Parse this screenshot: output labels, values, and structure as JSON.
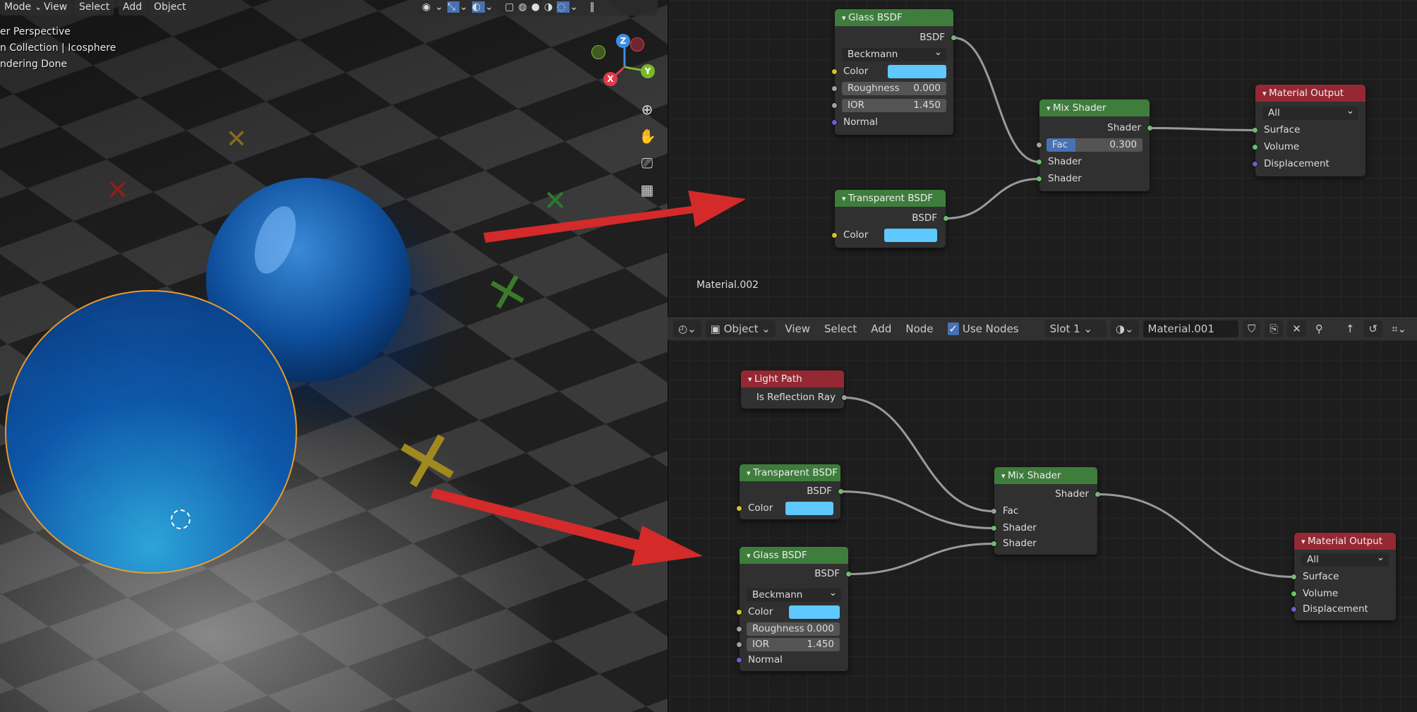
{
  "viewport": {
    "menu": [
      "Mode",
      "View",
      "Select",
      "Add",
      "Object"
    ],
    "overlay": [
      "er Perspective",
      "n Collection | Icosphere",
      "ndering Done"
    ],
    "gizmo": {
      "z": "Z",
      "y": "Y",
      "x": "X"
    },
    "tools": [
      "zoom-icon",
      "hand-icon",
      "camera-icon",
      "grid-icon"
    ]
  },
  "top_editor": {
    "material_label": "Material.002",
    "glass": {
      "title": "Glass BSDF",
      "out": "BSDF",
      "distribution": "Beckmann",
      "color": "Color",
      "roughness_label": "Roughness",
      "roughness": "0.000",
      "ior_label": "IOR",
      "ior": "1.450",
      "normal": "Normal",
      "swatch": "#5ec8ff"
    },
    "transparent": {
      "title": "Transparent BSDF",
      "out": "BSDF",
      "color": "Color"
    },
    "mix": {
      "title": "Mix Shader",
      "out": "Shader",
      "fac_label": "Fac",
      "fac": "0.300",
      "in1": "Shader",
      "in2": "Shader",
      "fac_fraction": 0.3
    },
    "output": {
      "title": "Material Output",
      "target": "All",
      "surface": "Surface",
      "volume": "Volume",
      "displacement": "Displacement"
    }
  },
  "header": {
    "mode": "Object",
    "menus": [
      "View",
      "Select",
      "Add",
      "Node"
    ],
    "use_nodes": "Use Nodes",
    "use_nodes_checked": true,
    "slot": "Slot 1",
    "material": "Material.001"
  },
  "bottom_editor": {
    "light_path": {
      "title": "Light Path",
      "out": "Is Reflection Ray"
    },
    "transparent": {
      "title": "Transparent BSDF",
      "out": "BSDF",
      "color": "Color"
    },
    "glass": {
      "title": "Glass BSDF",
      "out": "BSDF",
      "distribution": "Beckmann",
      "color": "Color",
      "roughness_label": "Roughness",
      "roughness": "0.000",
      "ior_label": "IOR",
      "ior": "1.450",
      "normal": "Normal"
    },
    "mix": {
      "title": "Mix Shader",
      "out": "Shader",
      "fac": "Fac",
      "in1": "Shader",
      "in2": "Shader"
    },
    "output": {
      "title": "Material Output",
      "target": "All",
      "surface": "Surface",
      "volume": "Volume",
      "displacement": "Displacement"
    }
  },
  "colors": {
    "arrow": "#d42a2a",
    "node_green": "#3e7d3c",
    "node_red": "#962833",
    "selection": "#f0a030"
  }
}
